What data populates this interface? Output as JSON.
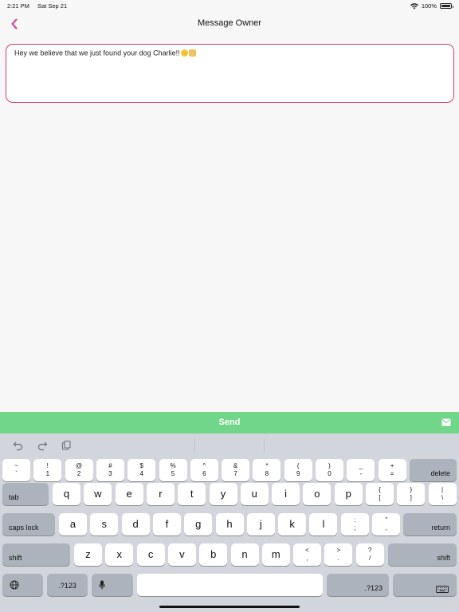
{
  "status": {
    "time": "2:21 PM",
    "date": "Sat Sep 21",
    "battery": "100%"
  },
  "nav": {
    "title": "Message Owner"
  },
  "message": {
    "text": "Hey we believe that we just found your dog Charlie!!"
  },
  "send": {
    "label": "Send"
  },
  "keyboard": {
    "num_row": [
      {
        "t": "~",
        "b": "`"
      },
      {
        "t": "!",
        "b": "1"
      },
      {
        "t": "@",
        "b": "2"
      },
      {
        "t": "#",
        "b": "3"
      },
      {
        "t": "$",
        "b": "4"
      },
      {
        "t": "%",
        "b": "5"
      },
      {
        "t": "^",
        "b": "6"
      },
      {
        "t": "&",
        "b": "7"
      },
      {
        "t": "*",
        "b": "8"
      },
      {
        "t": "(",
        "b": "9"
      },
      {
        "t": ")",
        "b": "0"
      },
      {
        "t": "_",
        "b": "-"
      },
      {
        "t": "+",
        "b": "="
      }
    ],
    "delete": "delete",
    "tab": "tab",
    "row1": [
      "q",
      "w",
      "e",
      "r",
      "t",
      "y",
      "u",
      "i",
      "o",
      "p"
    ],
    "row1_extra": [
      {
        "t": "{",
        "b": "["
      },
      {
        "t": "}",
        "b": "]"
      },
      {
        "t": "|",
        "b": "\\"
      }
    ],
    "caps": "caps lock",
    "row2": [
      "a",
      "s",
      "d",
      "f",
      "g",
      "h",
      "j",
      "k",
      "l"
    ],
    "row2_extra": [
      {
        "t": ":",
        "b": ";"
      },
      {
        "t": "\"",
        "b": ","
      }
    ],
    "return": "return",
    "shift": "shift",
    "row3": [
      "z",
      "x",
      "c",
      "v",
      "b",
      "n",
      "m"
    ],
    "row3_extra": [
      {
        "t": "<",
        "b": ","
      },
      {
        "t": ">",
        "b": "."
      },
      {
        "t": "?",
        "b": "/"
      }
    ],
    "numbers": ".?123"
  }
}
